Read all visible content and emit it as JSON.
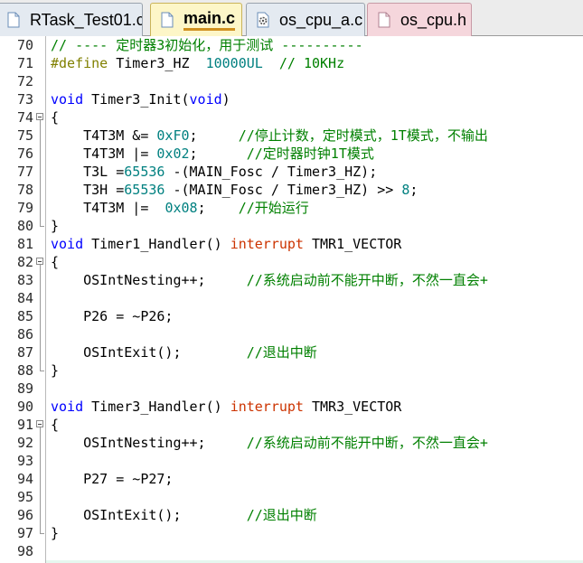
{
  "tabs": [
    {
      "label": "RTask_Test01.c",
      "icon": "c-file-icon",
      "active": false
    },
    {
      "label": "main.c",
      "icon": "c-file-icon",
      "active": true
    },
    {
      "label": "os_cpu_a.c",
      "icon": "asm-gear-file-icon",
      "active": false
    },
    {
      "label": "os_cpu.h",
      "icon": "h-file-icon",
      "active": false
    }
  ],
  "lines": [
    {
      "n": "70",
      "fold": "",
      "tokens": [
        [
          "cm",
          "// ---- 定时器3初始化，用于测试 ----------"
        ]
      ]
    },
    {
      "n": "71",
      "fold": "",
      "tokens": [
        [
          "pp",
          "#define"
        ],
        [
          "tx",
          " Timer3_HZ  "
        ],
        [
          "num",
          "10000UL"
        ],
        [
          "tx",
          "  "
        ],
        [
          "cm",
          "// 10KHz"
        ]
      ]
    },
    {
      "n": "72",
      "fold": "",
      "tokens": []
    },
    {
      "n": "73",
      "fold": "",
      "tokens": [
        [
          "kw",
          "void"
        ],
        [
          "tx",
          " Timer3_Init("
        ],
        [
          "kw",
          "void"
        ],
        [
          "tx",
          ")"
        ]
      ]
    },
    {
      "n": "74",
      "fold": "open",
      "tokens": [
        [
          "tx",
          "{"
        ]
      ]
    },
    {
      "n": "75",
      "fold": "",
      "tokens": [
        [
          "tx",
          "    T4T3M &= "
        ],
        [
          "num",
          "0xF0"
        ],
        [
          "tx",
          ";     "
        ],
        [
          "cm",
          "//停止计数，定时模式，1T模式，不输出"
        ]
      ]
    },
    {
      "n": "76",
      "fold": "",
      "tokens": [
        [
          "tx",
          "    T4T3M |= "
        ],
        [
          "num",
          "0x02"
        ],
        [
          "tx",
          ";      "
        ],
        [
          "cm",
          "//定时器时钟1T模式"
        ]
      ]
    },
    {
      "n": "77",
      "fold": "",
      "tokens": [
        [
          "tx",
          "    T3L ="
        ],
        [
          "num",
          "65536"
        ],
        [
          "tx",
          " -(MAIN_Fosc / Timer3_HZ);"
        ]
      ]
    },
    {
      "n": "78",
      "fold": "",
      "tokens": [
        [
          "tx",
          "    T3H ="
        ],
        [
          "num",
          "65536"
        ],
        [
          "tx",
          " -(MAIN_Fosc / Timer3_HZ) >> "
        ],
        [
          "num",
          "8"
        ],
        [
          "tx",
          ";"
        ]
      ]
    },
    {
      "n": "79",
      "fold": "",
      "tokens": [
        [
          "tx",
          "    T4T3M |=  "
        ],
        [
          "num",
          "0x08"
        ],
        [
          "tx",
          ";    "
        ],
        [
          "cm",
          "//开始运行"
        ]
      ]
    },
    {
      "n": "80",
      "fold": "end",
      "tokens": [
        [
          "tx",
          "}"
        ]
      ]
    },
    {
      "n": "81",
      "fold": "",
      "tokens": [
        [
          "kw",
          "void"
        ],
        [
          "tx",
          " Timer1_Handler() "
        ],
        [
          "kw2",
          "interrupt"
        ],
        [
          "tx",
          " TMR1_VECTOR"
        ]
      ]
    },
    {
      "n": "82",
      "fold": "open",
      "tokens": [
        [
          "tx",
          "{"
        ]
      ]
    },
    {
      "n": "83",
      "fold": "",
      "tokens": [
        [
          "tx",
          "    OSIntNesting++;     "
        ],
        [
          "cm",
          "//系统启动前不能开中断，不然一直会+"
        ]
      ]
    },
    {
      "n": "84",
      "fold": "",
      "tokens": []
    },
    {
      "n": "85",
      "fold": "",
      "tokens": [
        [
          "tx",
          "    P26 = ~P26;"
        ]
      ]
    },
    {
      "n": "86",
      "fold": "",
      "tokens": []
    },
    {
      "n": "87",
      "fold": "",
      "tokens": [
        [
          "tx",
          "    OSIntExit();        "
        ],
        [
          "cm",
          "//退出中断"
        ]
      ]
    },
    {
      "n": "88",
      "fold": "end",
      "tokens": [
        [
          "tx",
          "}"
        ]
      ]
    },
    {
      "n": "89",
      "fold": "",
      "tokens": []
    },
    {
      "n": "90",
      "fold": "",
      "tokens": [
        [
          "kw",
          "void"
        ],
        [
          "tx",
          " Timer3_Handler() "
        ],
        [
          "kw2",
          "interrupt"
        ],
        [
          "tx",
          " TMR3_VECTOR"
        ]
      ]
    },
    {
      "n": "91",
      "fold": "open",
      "tokens": [
        [
          "tx",
          "{"
        ]
      ]
    },
    {
      "n": "92",
      "fold": "",
      "tokens": [
        [
          "tx",
          "    OSIntNesting++;     "
        ],
        [
          "cm",
          "//系统启动前不能开中断，不然一直会+"
        ]
      ]
    },
    {
      "n": "93",
      "fold": "",
      "tokens": []
    },
    {
      "n": "94",
      "fold": "",
      "tokens": [
        [
          "tx",
          "    P27 = ~P27;"
        ]
      ]
    },
    {
      "n": "95",
      "fold": "",
      "tokens": []
    },
    {
      "n": "96",
      "fold": "",
      "tokens": [
        [
          "tx",
          "    OSIntExit();        "
        ],
        [
          "cm",
          "//退出中断"
        ]
      ]
    },
    {
      "n": "97",
      "fold": "end",
      "tokens": [
        [
          "tx",
          "}"
        ]
      ]
    },
    {
      "n": "98",
      "fold": "",
      "tokens": []
    }
  ],
  "colors": {
    "keyword": "#0000ff",
    "interrupt": "#cc3300",
    "preprocessor": "#808000",
    "number": "#008080",
    "comment": "#008000"
  }
}
